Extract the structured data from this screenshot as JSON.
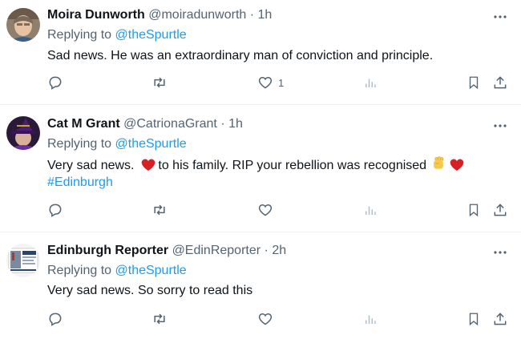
{
  "tweets": [
    {
      "name": "Moira Dunworth",
      "handle": "@moiradunworth",
      "separator": "·",
      "time": "1h",
      "replying_prefix": "Replying to ",
      "replying_to": "@theSpurtle",
      "text": "Sad news. He was an extraordinary man of conviction and principle.",
      "like_count": "1"
    },
    {
      "name": "Cat M Grant",
      "handle": "@CatrionaGrant",
      "separator": "·",
      "time": "1h",
      "replying_prefix": "Replying to ",
      "replying_to": "@theSpurtle",
      "text_part1": "Very sad news.  ",
      "text_part2": "to his family. RIP your rebellion was recognised",
      "hashtag": "#Edinburgh",
      "like_count": ""
    },
    {
      "name": "Edinburgh Reporter",
      "handle": "@EdinReporter",
      "separator": "·",
      "time": "2h",
      "replying_prefix": "Replying to ",
      "replying_to": "@theSpurtle",
      "text": "Very sad news. So sorry to read this",
      "like_count": ""
    }
  ],
  "icons": {
    "more": "more-horizontal-icon",
    "reply": "reply-bubble-icon",
    "retweet": "retweet-icon",
    "like": "heart-outline-icon",
    "views": "bar-chart-icon",
    "bookmark": "bookmark-icon",
    "share": "share-upload-icon"
  },
  "colors": {
    "link": "#1d9bf0",
    "secondary": "#536471",
    "heart": "#d81f26",
    "fist": "#f6c94c"
  }
}
